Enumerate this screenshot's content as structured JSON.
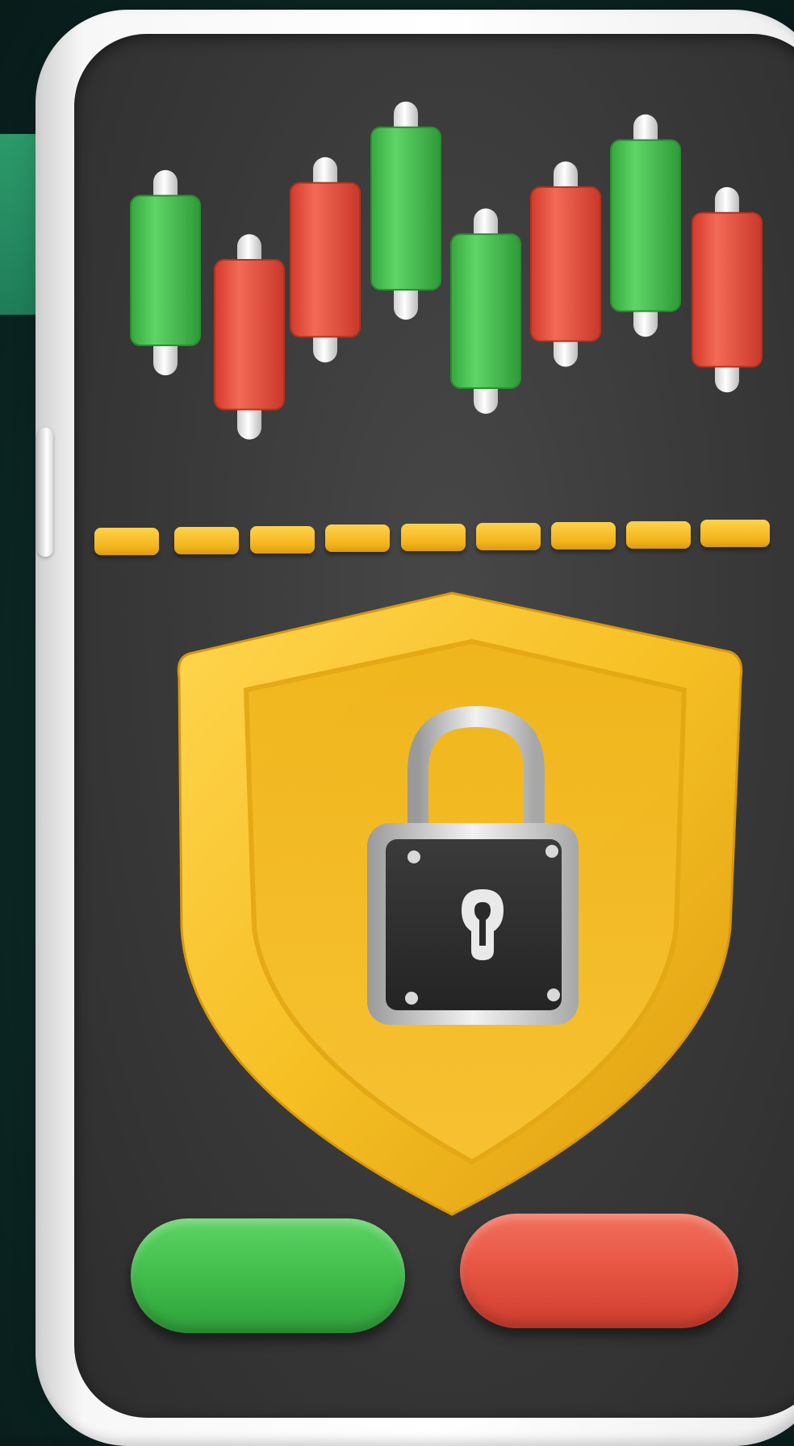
{
  "scene": {
    "colors": {
      "background": "#0d2d29",
      "phone_frame": "#f5f5f5",
      "screen": "#3a3a3a",
      "bull": "#4cc653",
      "bear": "#e8503f",
      "accent_yellow": "#f4b920",
      "lock_body": "#2f2f2f"
    },
    "icons": [
      "candlestick-chart-icon",
      "shield-icon",
      "padlock-icon",
      "keyhole-icon"
    ],
    "chart_data": {
      "type": "candlestick",
      "candles": [
        {
          "direction": "up",
          "open": 40,
          "close": 75,
          "low": 33,
          "high": 81
        },
        {
          "direction": "down",
          "open": 60,
          "close": 25,
          "low": 18,
          "high": 66
        },
        {
          "direction": "down",
          "open": 78,
          "close": 42,
          "low": 36,
          "high": 84
        },
        {
          "direction": "up",
          "open": 53,
          "close": 91,
          "low": 46,
          "high": 97
        },
        {
          "direction": "up",
          "open": 30,
          "close": 66,
          "low": 24,
          "high": 72
        },
        {
          "direction": "down",
          "open": 77,
          "close": 41,
          "low": 35,
          "high": 83
        },
        {
          "direction": "up",
          "open": 48,
          "close": 88,
          "low": 42,
          "high": 94
        },
        {
          "direction": "down",
          "open": 71,
          "close": 35,
          "low": 29,
          "high": 77
        }
      ],
      "baseline": "dashed"
    },
    "action_buttons": [
      {
        "name": "buy-button",
        "color": "green"
      },
      {
        "name": "sell-button",
        "color": "red"
      }
    ]
  }
}
